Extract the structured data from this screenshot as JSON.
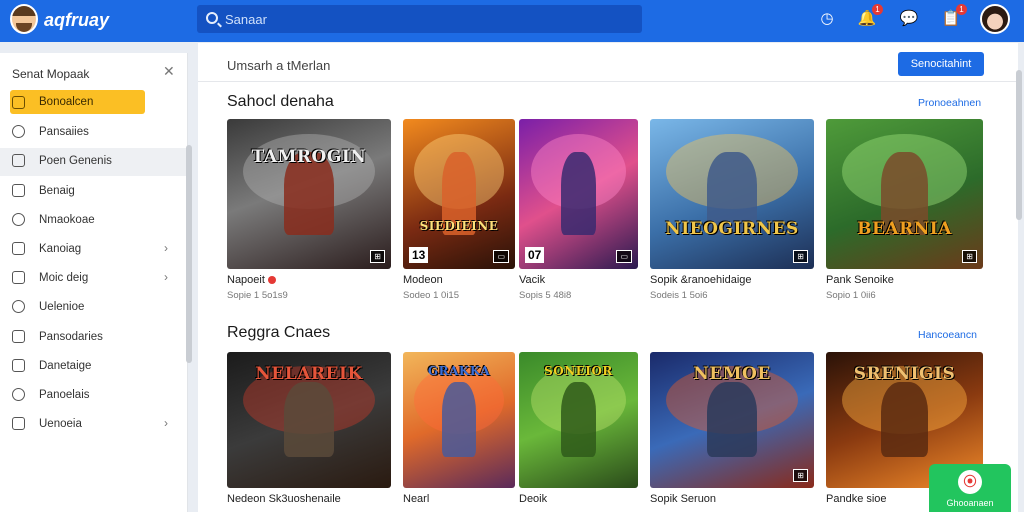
{
  "header": {
    "brand": "aqfruay",
    "search_placeholder": "Sanaar",
    "icons": [
      {
        "name": "clock-icon",
        "glyph": "◷",
        "badge": ""
      },
      {
        "name": "notifications-icon",
        "glyph": "🔔",
        "badge": "1"
      },
      {
        "name": "chat-icon",
        "glyph": "💬",
        "badge": ""
      },
      {
        "name": "inbox-icon",
        "glyph": "📋",
        "badge": "1"
      }
    ]
  },
  "sidebar": {
    "heading": "Senat Mopaak",
    "items": [
      {
        "label": "Bonoalcen",
        "active": true,
        "chevron": false
      },
      {
        "label": "Pansaiies",
        "active": false,
        "chevron": false
      },
      {
        "label": "Poen Genenis",
        "active": false,
        "chevron": false
      },
      {
        "label": "Benaig",
        "active": false,
        "chevron": false
      },
      {
        "label": "Nmaokoae",
        "active": false,
        "chevron": false
      },
      {
        "label": "Kanoiag",
        "active": false,
        "chevron": true
      },
      {
        "label": "Moic deig",
        "active": false,
        "chevron": true
      },
      {
        "label": "Uelenioe",
        "active": false,
        "chevron": false
      },
      {
        "label": "Pansodaries",
        "active": false,
        "chevron": false
      },
      {
        "label": "Danetaige",
        "active": false,
        "chevron": false
      },
      {
        "label": "Panoelais",
        "active": false,
        "chevron": false
      },
      {
        "label": "Uenoeia",
        "active": false,
        "chevron": true
      }
    ]
  },
  "main": {
    "title": "Umsarh a tMerlan",
    "primary_button": "Senocitahint",
    "sections": [
      {
        "title": "Sahocl denaha",
        "see_all": "Pronoeahnen",
        "cards": [
          {
            "name": "Napoeit",
            "meta": "Sopie 1 5o1s9",
            "art": "TAMROGIN",
            "corner": "⊞",
            "corner_left": "",
            "live": true
          },
          {
            "name": "Modeon",
            "meta": "Sodeo 1 0i15",
            "art": "SIEDIEINE",
            "corner": "▭",
            "corner_left": "13",
            "live": false
          },
          {
            "name": "Vacik",
            "meta": "Sopis 5 48i8",
            "art": "",
            "corner": "▭",
            "corner_left": "07",
            "live": false
          },
          {
            "name": "Sopik &ranoehidaige",
            "meta": "Sodeis 1 5oi6",
            "art": "NIEOGIRNES",
            "corner": "⊞",
            "corner_left": "",
            "live": false
          },
          {
            "name": "Pank Senoike",
            "meta": "Sopio 1 0ii6",
            "art": "BEARNIA",
            "corner": "⊞",
            "corner_left": "",
            "live": false
          }
        ]
      },
      {
        "title": "Reggra Cnaes",
        "see_all": "Hancoeancn",
        "cards": [
          {
            "name": "Nedeon Sk3uoshenaile",
            "meta": "",
            "art": "NELAREIK",
            "corner": "",
            "corner_left": "",
            "live": false
          },
          {
            "name": "Nearl",
            "meta": "",
            "art": "GRAKKA",
            "corner": "",
            "corner_left": "",
            "live": false
          },
          {
            "name": "Deoik",
            "meta": "",
            "art": "SONEIOR",
            "corner": "",
            "corner_left": "",
            "live": false
          },
          {
            "name": "Sopik Seruon",
            "meta": "",
            "art": "NEMOE",
            "corner": "⊞",
            "corner_left": "",
            "live": false
          },
          {
            "name": "Pandke sioe",
            "meta": "",
            "art": "SRENIGIS",
            "corner": "",
            "corner_left": "",
            "live": false
          }
        ]
      }
    ]
  },
  "fab": {
    "label": "Ghooanaen",
    "glyph": "⦿"
  },
  "colors": {
    "brand": "#1d6be4",
    "accent": "#fbbf24",
    "fab": "#22c55e",
    "live": "#e53935"
  }
}
